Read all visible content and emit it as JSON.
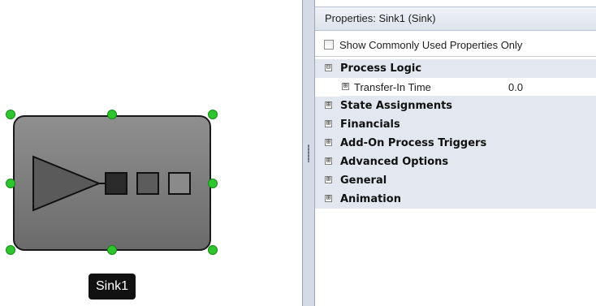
{
  "canvas": {
    "object_label": "Sink1",
    "object_icon": "sink-icon",
    "colors": {
      "object_fill": "#7d7d7d",
      "selection_handle": "#2ec52e",
      "label_background": "#111111"
    }
  },
  "properties_panel": {
    "title": "Properties: Sink1 (Sink)",
    "filter_checkbox": {
      "label": "Show Commonly Used Properties Only",
      "checked": false
    },
    "categories": [
      {
        "label": "Process Logic",
        "expanded": true,
        "expander_symbol": "⊟",
        "properties": [
          {
            "name": "Transfer-In Time",
            "value": "0.0",
            "expander_symbol": "⊞"
          }
        ]
      },
      {
        "label": "State Assignments",
        "expanded": false,
        "expander_symbol": "⊞"
      },
      {
        "label": "Financials",
        "expanded": false,
        "expander_symbol": "⊞"
      },
      {
        "label": "Add-On Process Triggers",
        "expanded": false,
        "expander_symbol": "⊞"
      },
      {
        "label": "Advanced Options",
        "expanded": false,
        "expander_symbol": "⊞"
      },
      {
        "label": "General",
        "expanded": false,
        "expander_symbol": "⊞"
      },
      {
        "label": "Animation",
        "expanded": false,
        "expander_symbol": "⊞"
      }
    ],
    "colors": {
      "category_background": "#e3e8f0",
      "header_background": "#dde3ec"
    }
  }
}
